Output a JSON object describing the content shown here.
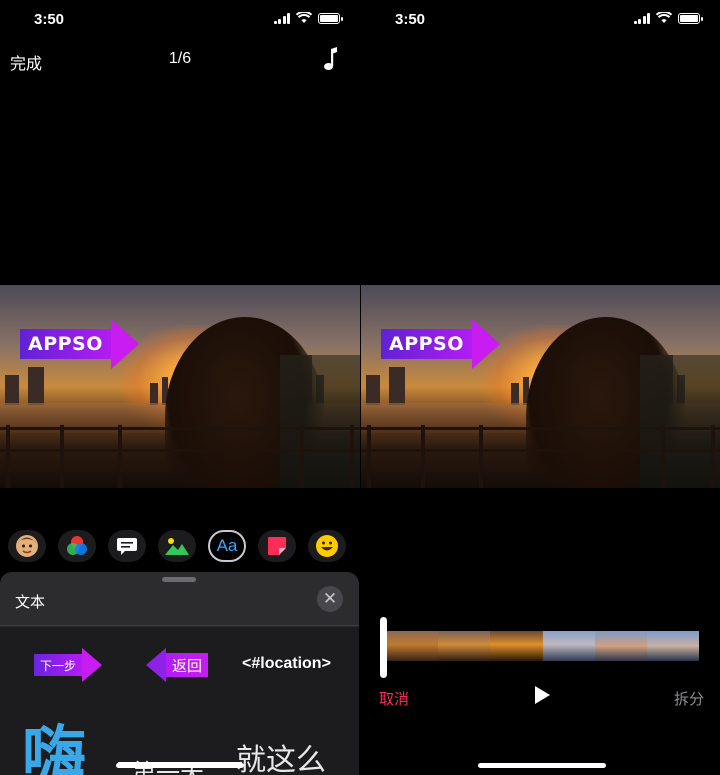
{
  "left": {
    "status": {
      "time": "3:50"
    },
    "topbar": {
      "done": "完成",
      "counter": "1/6"
    },
    "photo_sticker": "APPSO",
    "tools": [
      "memoji",
      "color-effects",
      "speech-bubble",
      "photo",
      "text",
      "sticker",
      "emoji"
    ],
    "tool_text_label": "Aa",
    "sheet": {
      "title": "文本",
      "next": "下一步",
      "back": "返回",
      "location": "<#location>",
      "hai": "嗨",
      "day": "第一天",
      "just": "就这么"
    }
  },
  "right": {
    "status": {
      "time": "3:50"
    },
    "photo_sticker": "APPSO",
    "cancel": "取消",
    "split": "拆分"
  },
  "colors": {
    "accent_blue": "#3aa8ff",
    "cancel_red": "#ff2d55",
    "sticker_purple": "#b21cf2"
  }
}
